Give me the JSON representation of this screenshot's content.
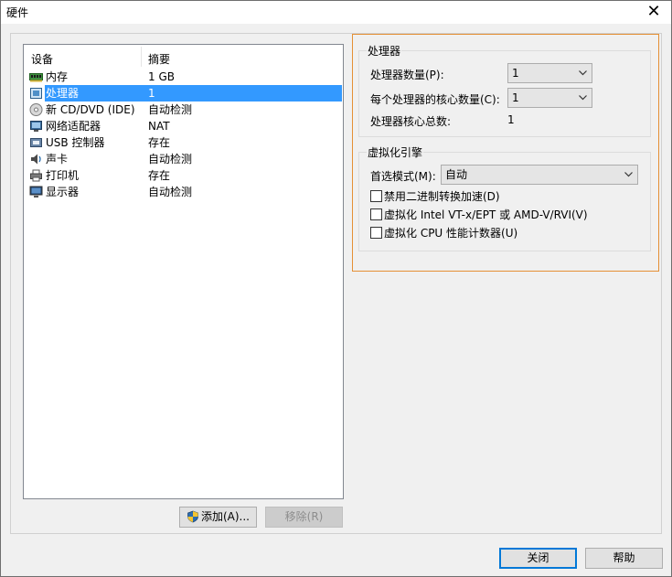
{
  "window": {
    "title": "硬件"
  },
  "device_list": {
    "col_device": "设备",
    "col_summary": "摘要",
    "items": [
      {
        "name": "内存",
        "summary": "1 GB",
        "icon": "memory-icon"
      },
      {
        "name": "处理器",
        "summary": "1",
        "icon": "processor-icon",
        "selected": true
      },
      {
        "name": "新 CD/DVD (IDE)",
        "summary": "自动检测",
        "icon": "cd-dvd-icon"
      },
      {
        "name": "网络适配器",
        "summary": "NAT",
        "icon": "network-adapter-icon"
      },
      {
        "name": "USB 控制器",
        "summary": "存在",
        "icon": "usb-icon"
      },
      {
        "name": "声卡",
        "summary": "自动检测",
        "icon": "sound-card-icon"
      },
      {
        "name": "打印机",
        "summary": "存在",
        "icon": "printer-icon"
      },
      {
        "name": "显示器",
        "summary": "自动检测",
        "icon": "display-icon"
      }
    ],
    "add_label": "添加(A)...",
    "remove_label": "移除(R)"
  },
  "processor_group": {
    "label": "处理器",
    "count_label": "处理器数量(P):",
    "count_value": "1",
    "cores_label": "每个处理器的核心数量(C):",
    "cores_value": "1",
    "total_label": "处理器核心总数:",
    "total_value": "1"
  },
  "virtualization_group": {
    "label": "虚拟化引擎",
    "mode_label": "首选模式(M):",
    "mode_value": "自动",
    "options": [
      {
        "label": "禁用二进制转换加速(D)",
        "checked": false
      },
      {
        "label": "虚拟化 Intel VT-x/EPT 或 AMD-V/RVI(V)",
        "checked": false
      },
      {
        "label": "虚拟化 CPU 性能计数器(U)",
        "checked": false
      }
    ]
  },
  "footer": {
    "close_label": "关闭",
    "help_label": "帮助"
  },
  "colors": {
    "selection": "#3399ff",
    "focus_frame": "#e59035",
    "primary_border": "#0078d7"
  }
}
